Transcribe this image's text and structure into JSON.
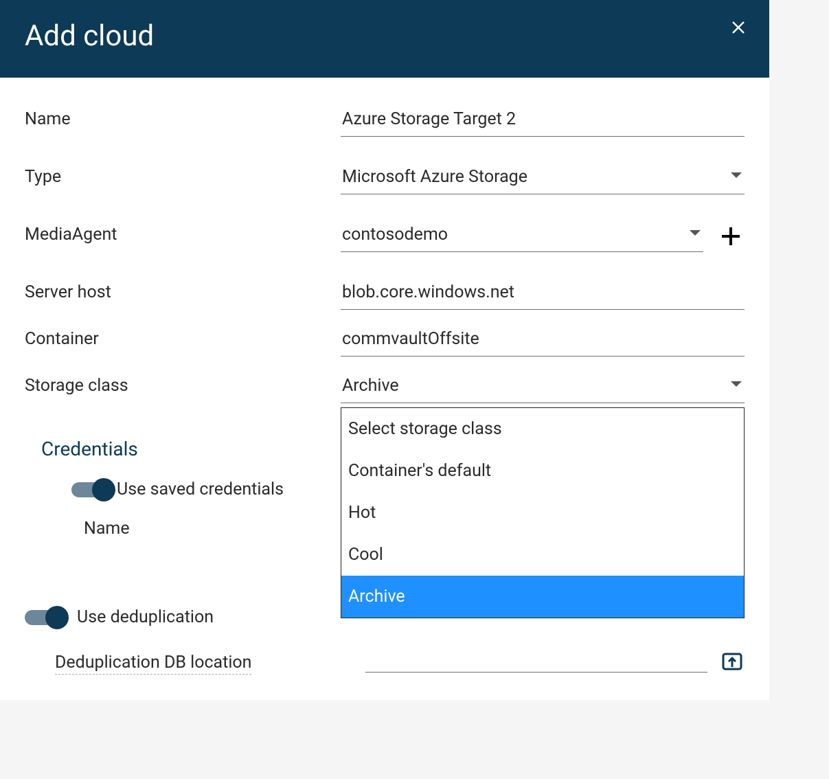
{
  "header": {
    "title": "Add cloud"
  },
  "form": {
    "name": {
      "label": "Name",
      "value": "Azure Storage Target 2"
    },
    "type": {
      "label": "Type",
      "value": "Microsoft Azure Storage"
    },
    "mediaagent": {
      "label": "MediaAgent",
      "value": "contosodemo"
    },
    "serverhost": {
      "label": "Server host",
      "value": "blob.core.windows.net"
    },
    "container": {
      "label": "Container",
      "value": "commvaultOffsite"
    },
    "storageclass": {
      "label": "Storage class",
      "value": "Archive",
      "options": [
        {
          "label": "Select storage class",
          "selected": false
        },
        {
          "label": "Container's default",
          "selected": false
        },
        {
          "label": "Hot",
          "selected": false
        },
        {
          "label": "Cool",
          "selected": false
        },
        {
          "label": "Archive",
          "selected": true
        }
      ]
    }
  },
  "credentials": {
    "section_title": "Credentials",
    "use_saved": {
      "label": "Use saved credentials",
      "on": true
    },
    "name_label": "Name"
  },
  "dedup": {
    "use_label": "Use deduplication",
    "on": true,
    "location_label": "Deduplication DB location"
  }
}
